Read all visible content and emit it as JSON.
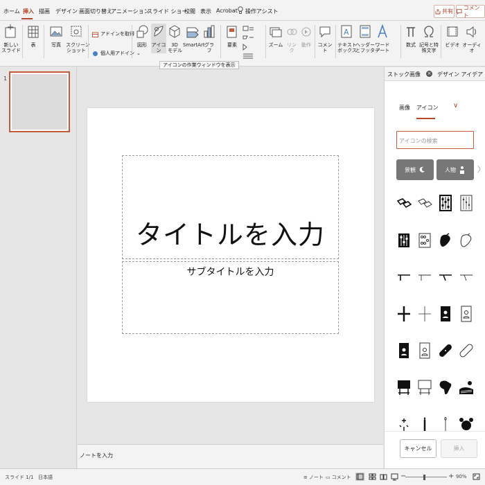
{
  "tabs": [
    {
      "label": "ホーム",
      "active": false
    },
    {
      "label": "挿入",
      "active": true
    },
    {
      "label": "描画",
      "active": false
    },
    {
      "label": "デザイン",
      "active": false
    },
    {
      "label": "画面切り替え",
      "active": false
    },
    {
      "label": "アニメーション",
      "active": false
    },
    {
      "label": "スライド ショー",
      "active": false
    },
    {
      "label": "校閲",
      "active": false
    },
    {
      "label": "表示",
      "active": false
    },
    {
      "label": "Acrobat",
      "active": false
    },
    {
      "label": "操作アシスト",
      "active": false
    }
  ],
  "header": {
    "share_label": "共有",
    "comment_label": "コメント"
  },
  "ribbon": {
    "new_slide": "新しい\nスライド",
    "table": "表",
    "photo": "写真",
    "screenshot": "スクリーン\nショット",
    "get_addins": "アドインを取得",
    "my_addins": "個人用アドイン",
    "shapes": "図形",
    "icons": "アイコン",
    "model3d": "3D\nモデル",
    "smartart": "SmartArt",
    "graph": "グラフ",
    "elements": "要素",
    "zoom": "ズーム",
    "link": "リンク",
    "action": "動作",
    "comment": "コメント",
    "textbox": "テキスト\nボックス",
    "header_footer": "ヘッダー\nとフッター",
    "wordart": "ワード\nアート",
    "equation": "数式",
    "symbol": "記号と特殊文字",
    "video": "ビデオ",
    "audio": "オーディオ",
    "tooltip": "アイコンの作業ウィンドウを表示"
  },
  "thumbnails": {
    "number": "1"
  },
  "slide": {
    "title": "タイトルを入力",
    "subtitle": "サブタイトルを入力"
  },
  "notes": {
    "placeholder": "ノートを入力"
  },
  "pane": {
    "tab_stock": "ストック画像",
    "tab_design": "デザイン アイデア",
    "subtab_image": "画像",
    "subtab_icon": "アイコン",
    "search_placeholder": "アイコンの検索",
    "categories": [
      "景観",
      "人物"
    ],
    "cancel_label": "キャンセル",
    "insert_label": "挿入"
  },
  "status": {
    "slide_count": "スライド 1/1",
    "language": "日本語",
    "notes_label": "ノート",
    "comments_label": "コメント",
    "zoom": "90%"
  },
  "colors": {
    "accent": "#b7472a"
  }
}
